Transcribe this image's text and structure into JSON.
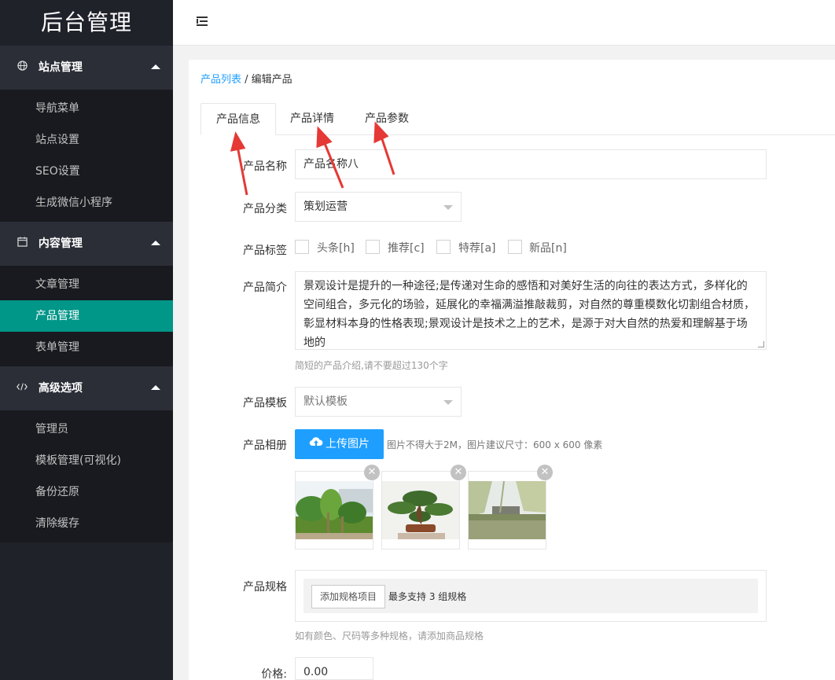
{
  "sidebar": {
    "logo": "后台管理",
    "groups": [
      {
        "title": "站点管理",
        "icon": "globe-icon",
        "items": [
          "导航菜单",
          "站点设置",
          "SEO设置",
          "生成微信小程序"
        ]
      },
      {
        "title": "内容管理",
        "icon": "calendar-icon",
        "items": [
          "文章管理",
          "产品管理",
          "表单管理"
        ],
        "active_item": "产品管理"
      },
      {
        "title": "高级选项",
        "icon": "code-icon",
        "items": [
          "管理员",
          "模板管理(可视化)",
          "备份还原",
          "清除缓存"
        ]
      }
    ]
  },
  "breadcrumb": {
    "link": "产品列表",
    "separator": " / ",
    "current": "编辑产品"
  },
  "tabs": [
    "产品信息",
    "产品详情",
    "产品参数"
  ],
  "form": {
    "name_label": "产品名称",
    "name_value": "产品名称八",
    "category_label": "产品分类",
    "category_value": "策划运营",
    "tags_label": "产品标签",
    "tags": [
      "头条[h]",
      "推荐[c]",
      "特荐[a]",
      "新品[n]"
    ],
    "intro_label": "产品简介",
    "intro_value": "景观设计是提升的一种途径;是传递对生命的感悟和对美好生活的向往的表达方式，多样化的空间组合，多元化的场验，延展化的幸福满溢推敲裁剪，对自然的尊重模数化切割组合材质，彰显材料本身的性格表现;景观设计是技术之上的艺术，是源于对大自然的热爱和理解基于场地的",
    "intro_hint": "简短的产品介绍,请不要超过130个字",
    "template_label": "产品模板",
    "template_value": "默认模板",
    "album_label": "产品相册",
    "upload_label": "上传图片",
    "upload_hint": "图片不得大于2M，图片建议尺寸：600 x 600 像素",
    "spec_label": "产品规格",
    "spec_button": "添加规格项目",
    "spec_note": "最多支持 3 组规格",
    "spec_hint": "如有颜色、尺码等多种规格，请添加商品规格",
    "price_label": "价格:",
    "price_value": "0.00"
  },
  "colors": {
    "sidebar_bg": "#20222a",
    "active": "#009688",
    "primary": "#1e9fff",
    "annotation": "#e53935"
  }
}
